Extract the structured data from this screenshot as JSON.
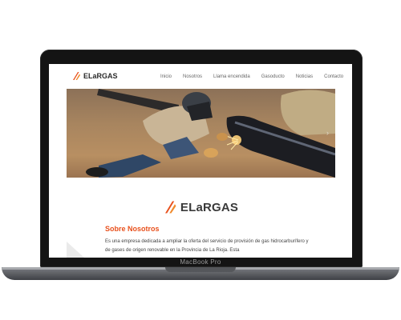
{
  "site": {
    "logo_text": "ELaRGAS",
    "nav": [
      "Inicio",
      "Nosotros",
      "Llama encendida",
      "Gasoducto",
      "Noticias",
      "Contacto"
    ]
  },
  "hero": {
    "next_arrow": "›"
  },
  "content": {
    "brand": "ELaRGAS",
    "section_title": "Sobre Nosotros",
    "section_text": "Es una empresa dedicada a ampliar la oferta del servicio de provisión de gas hidrocarburífero y de gases de origen renovable en la Provincia de La Rioja. Esta"
  },
  "device": {
    "label": "MacBook Pro"
  },
  "colors": {
    "accent": "#e8501c",
    "lid": "#141414"
  }
}
